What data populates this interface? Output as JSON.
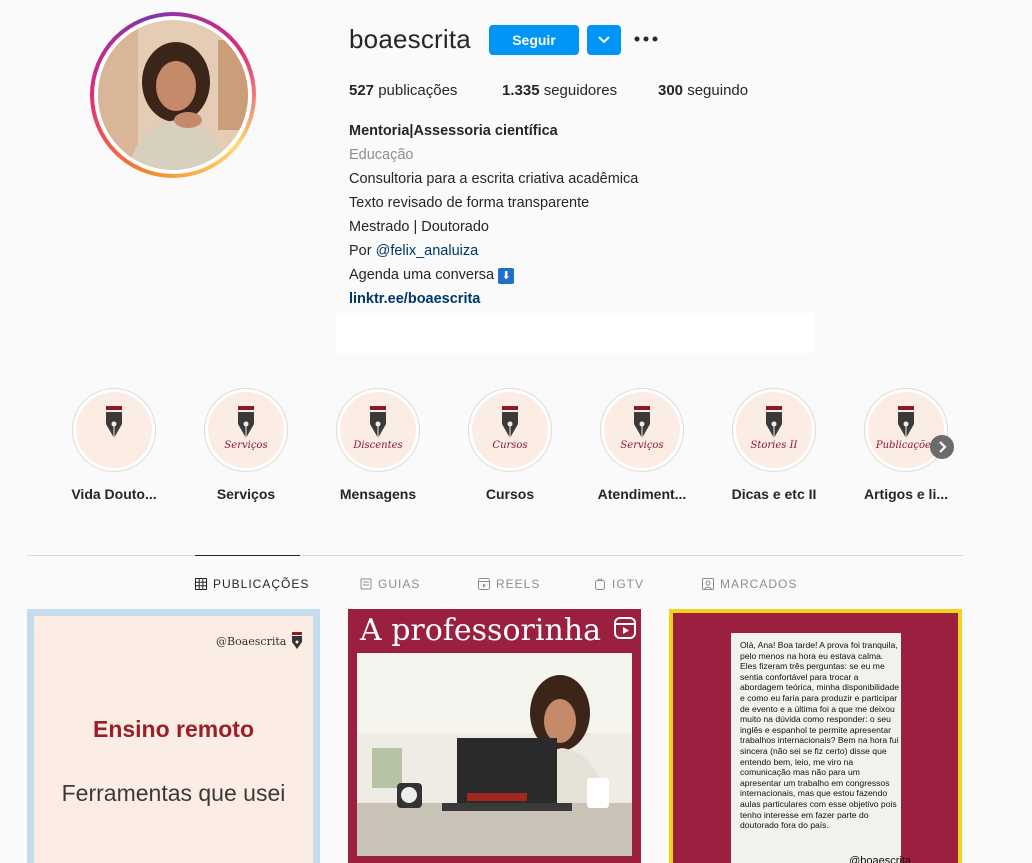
{
  "profile": {
    "username": "boaescrita",
    "follow_label": "Seguir",
    "stats": {
      "posts_count": "527",
      "posts_label": "publicações",
      "followers_count": "1.335",
      "followers_label": "seguidores",
      "following_count": "300",
      "following_label": "seguindo"
    },
    "bio": {
      "title": "Mentoria|Assessoria científica",
      "category": "Educação",
      "line1": "Consultoria para a escrita criativa acadêmica",
      "line2": "Texto revisado de forma transparente",
      "line3": "Mestrado | Doutorado",
      "by_prefix": "Por",
      "mention": "@felix_analuiza",
      "agenda": "Agenda uma conversa",
      "agenda_emoji": "⬇",
      "link": "linktr.ee/boaescrita"
    }
  },
  "highlights": [
    {
      "label": "Vida Douto...",
      "script": ""
    },
    {
      "label": "Serviços",
      "script": "Serviços"
    },
    {
      "label": "Mensagens",
      "script": "Discentes"
    },
    {
      "label": "Cursos",
      "script": "Cursos"
    },
    {
      "label": "Atendiment...",
      "script": "Serviços"
    },
    {
      "label": "Dicas e etc II",
      "script": "Stories II"
    },
    {
      "label": "Artigos e li...",
      "script": "Publicações"
    }
  ],
  "tabs": [
    {
      "label": "PUBLICAÇÕES",
      "icon": "grid-icon"
    },
    {
      "label": "GUIAS",
      "icon": "guide-icon"
    },
    {
      "label": "REELS",
      "icon": "reels-icon"
    },
    {
      "label": "IGTV",
      "icon": "igtv-icon"
    },
    {
      "label": "MARCADOS",
      "icon": "tagged-icon"
    }
  ],
  "posts": {
    "p1": {
      "handle": "@Boaescrita",
      "title": "Ensino remoto",
      "subtitle": "Ferramentas que usei"
    },
    "p2": {
      "title": "A professorinha"
    },
    "p3": {
      "message": "Olá,  Ana! Boa tarde! A prova foi tranquila,  pelo menos na hora eu estava calma. Eles fizeram três perguntas: se eu me sentia confortável para trocar a abordagem teórica,  minha disponibilidade e como eu faria para produzir e participar de evento e a última foi a que me deixou muito na dúvida como responder: o seu inglês e espanhol te permite apresentar trabalhos internacionais? Bem na hora fui sincera (não sei se fiz certo) disse que entendo bem, leio, me viro na comunicação mas não para um apresentar um trabalho em congressos internacionais, mas que estou fazendo aulas particulares com esse objetivo pois tenho interesse em fazer parte do doutorado fora do país.",
      "handle": "@boaescrita"
    }
  },
  "colors": {
    "accent": "#0095f6",
    "brand_burgundy": "#9b1f3f",
    "highlight_bg": "#fbece4"
  }
}
